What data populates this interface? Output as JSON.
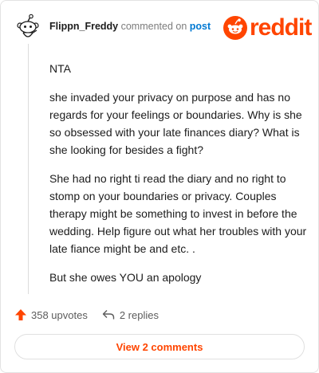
{
  "header": {
    "username": "Flippn_Freddy",
    "action_text": "commented on",
    "post_link": "post"
  },
  "brand": {
    "logo_text": "reddit",
    "accent_color": "#ff4500",
    "logo_icon": "reddit-snoo-icon"
  },
  "comment": {
    "paragraphs": [
      "NTA",
      "she invaded your privacy on purpose and has no regards for your feelings or boundaries. Why is she so obsessed with your late finances diary? What is she looking for besides a fight?",
      "She had no right ti read the diary and no right to stomp on your boundaries or privacy. Couples therapy might be something to invest in before the wedding. Help figure out what her troubles with your late fiance might be and etc. .",
      "But she owes YOU an apology"
    ]
  },
  "actions": {
    "upvotes_label": "358 upvotes",
    "replies_label": "2 replies",
    "upvote_icon": "upvote-arrow-icon",
    "reply_icon": "reply-arrow-icon",
    "upvote_color": "#ff4500"
  },
  "footer": {
    "view_comments_label": "View 2 comments"
  }
}
